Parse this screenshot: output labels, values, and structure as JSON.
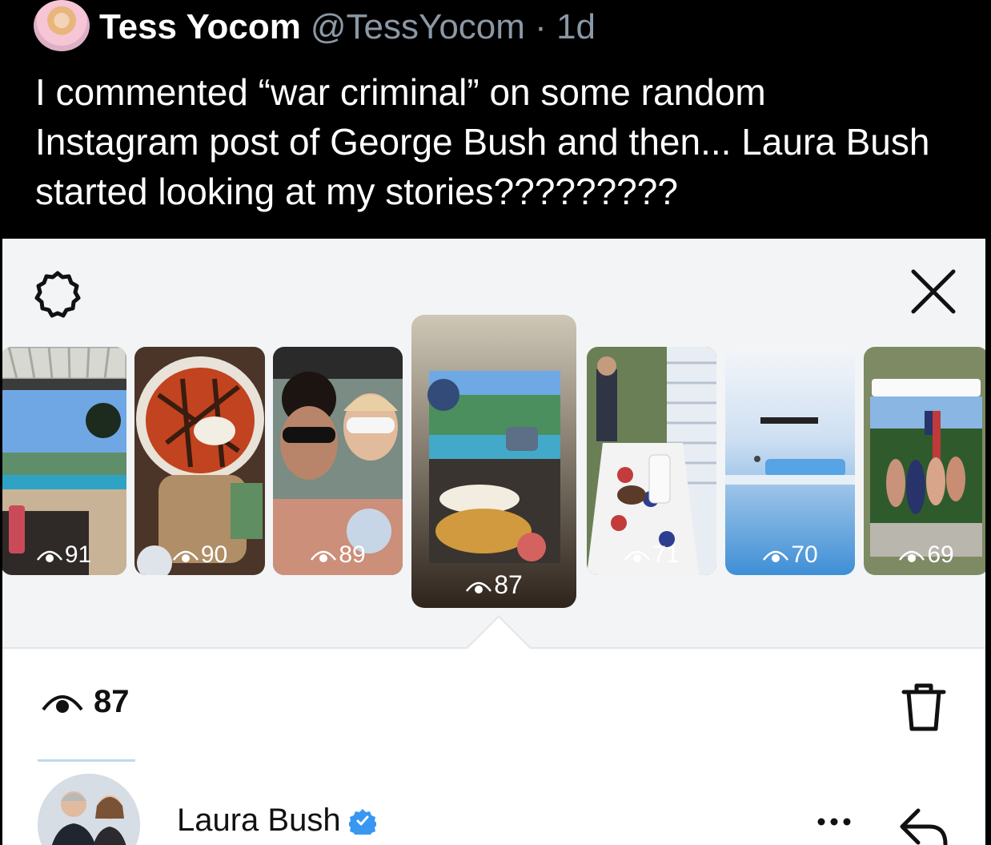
{
  "tweet": {
    "author_name": "Tess Yocom",
    "handle": "@TessYocom",
    "separator": "·",
    "time": "1d",
    "text": "I commented “war criminal” on some random Instagram post of George Bush and then... Laura Bush started looking at my stories?????????"
  },
  "viewer_panel": {
    "icons": {
      "settings": "settings-icon",
      "close": "close-icon",
      "delete": "trash-icon",
      "reply": "reply-icon",
      "more": "more-icon",
      "views": "eye-icon"
    },
    "stories": [
      {
        "views": "91"
      },
      {
        "views": "90"
      },
      {
        "views": "89"
      },
      {
        "views": "87",
        "selected": true
      },
      {
        "views": "71"
      },
      {
        "views": "70"
      },
      {
        "views": "69"
      }
    ],
    "selected_views": "87",
    "viewer": {
      "name": "Laura Bush",
      "verified": true
    },
    "colors": {
      "accent_blue": "#3897f0",
      "panel_bg": "#f3f4f6"
    }
  }
}
